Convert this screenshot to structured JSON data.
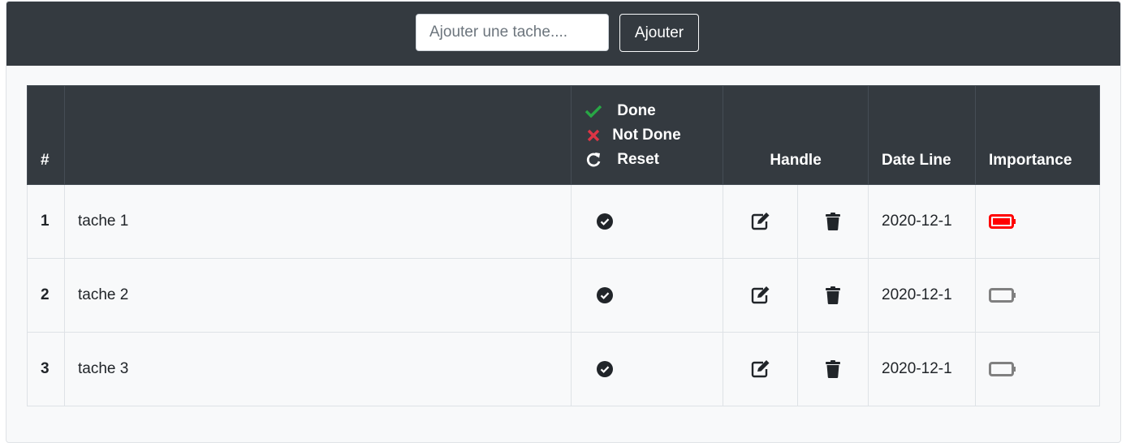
{
  "header": {
    "input_placeholder": "Ajouter une tache....",
    "input_value": "",
    "add_button": "Ajouter"
  },
  "table": {
    "columns": {
      "number": "#",
      "task": "",
      "status_legend": [
        {
          "label": "Done",
          "icon": "check-icon",
          "color": "#28a745"
        },
        {
          "label": "Not Done",
          "icon": "x-icon",
          "color": "#dc3545"
        },
        {
          "label": "Reset",
          "icon": "redo-icon",
          "color": "#ffffff"
        }
      ],
      "handle": "Handle",
      "date_line": "Date Line",
      "importance": "Importance"
    },
    "rows": [
      {
        "number": "1",
        "task": "tache 1",
        "status_icon": "check-circle-icon",
        "date": "2020-12-1",
        "importance": "high",
        "importance_color": "#ff0000"
      },
      {
        "number": "2",
        "task": "tache 2",
        "status_icon": "check-circle-icon",
        "date": "2020-12-1",
        "importance": "low",
        "importance_color": "#808080"
      },
      {
        "number": "3",
        "task": "tache 3",
        "status_icon": "check-circle-icon",
        "date": "2020-12-1",
        "importance": "low",
        "importance_color": "#808080"
      }
    ]
  },
  "colors": {
    "dark": "#343a40",
    "background": "#f8f9fa",
    "border": "#dee2e6"
  }
}
